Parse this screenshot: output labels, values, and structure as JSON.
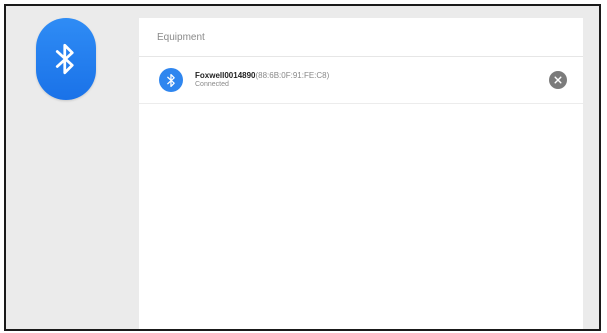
{
  "panel": {
    "title": "Equipment"
  },
  "device": {
    "name": "Foxwell0014890",
    "mac": "(88:6B:0F:91:FE:C8)",
    "status": "Connected"
  },
  "icons": {
    "main": "bluetooth-icon",
    "device": "bluetooth-icon",
    "remove": "close-icon"
  },
  "colors": {
    "accent": "#2f86ef",
    "background": "#ebebeb",
    "panel": "#ffffff",
    "close": "#7b7b7b"
  }
}
